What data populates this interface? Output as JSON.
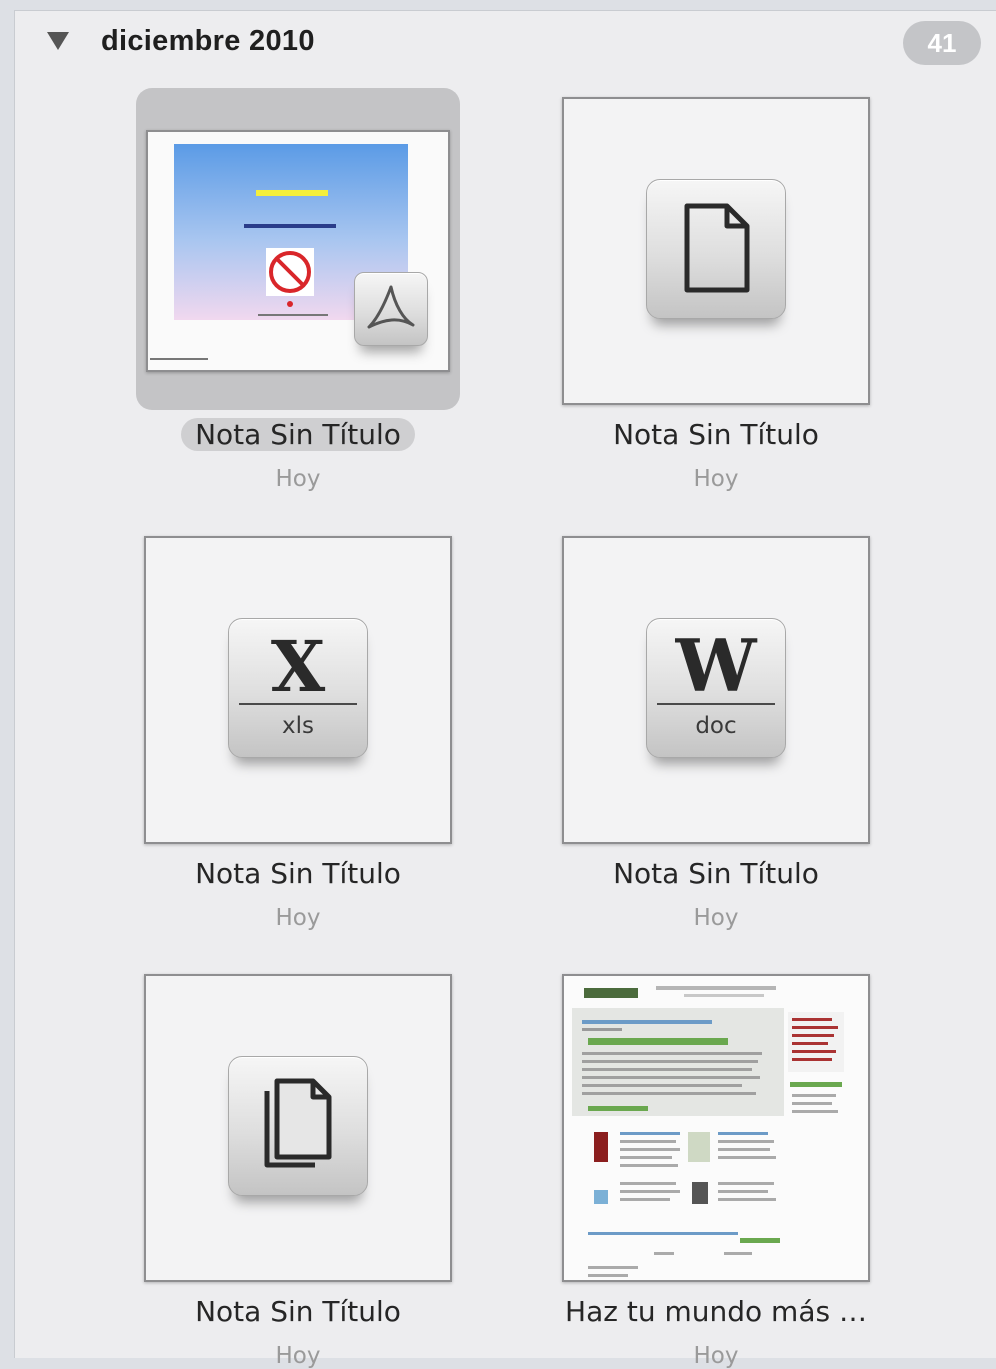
{
  "section": {
    "title": "diciembre 2010",
    "count": "41"
  },
  "items": [
    {
      "title": "Nota Sin Título",
      "date": "Hoy",
      "type": "pdf",
      "icon": "pdf-thumbnail",
      "selected": true
    },
    {
      "title": "Nota Sin Título",
      "date": "Hoy",
      "type": "document",
      "icon": "generic-document-icon"
    },
    {
      "title": "Nota Sin Título",
      "date": "Hoy",
      "type": "xls",
      "icon": "excel-icon",
      "glyph": "X",
      "ext": "xls"
    },
    {
      "title": "Nota Sin Título",
      "date": "Hoy",
      "type": "doc",
      "icon": "word-icon",
      "glyph": "W",
      "ext": "doc"
    },
    {
      "title": "Nota Sin Título",
      "date": "Hoy",
      "type": "documents",
      "icon": "multiple-documents-icon"
    },
    {
      "title": "Haz tu mundo más …",
      "date": "Hoy",
      "type": "webpage",
      "icon": "webpage-thumbnail"
    }
  ]
}
